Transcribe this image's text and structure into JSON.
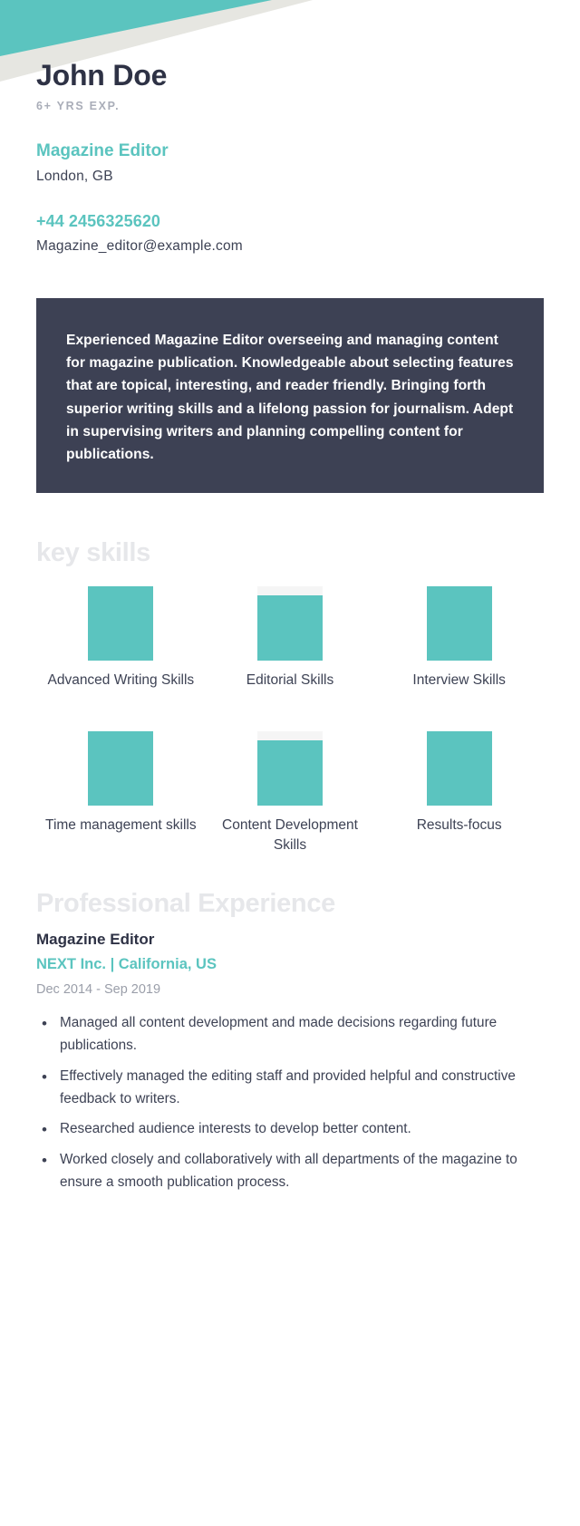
{
  "theme": {
    "accent": "#5bc4bf",
    "dark_panel": "#3d4154",
    "heading_ghost": "#e6e7ea",
    "body_text": "#3d4254",
    "muted_text": "#9a9ea9",
    "banner_gray": "#e6e6e1"
  },
  "header": {
    "full_name": "John Doe",
    "years_experience": "6+ YRS EXP."
  },
  "role": {
    "title": "Magazine Editor",
    "location": "London, GB"
  },
  "contact": {
    "phone": "+44 2456325620",
    "email": "Magazine_editor@example.com"
  },
  "summary": {
    "text": "Experienced Magazine Editor overseeing and managing content for magazine publication. Knowledgeable about selecting features that are topical, interesting, and reader friendly. Bringing forth superior writing skills and a lifelong passion for journalism. Adept in supervising writers and planning compelling content for publications."
  },
  "key_skills": {
    "heading": "key skills",
    "items": [
      {
        "label": "Advanced Writing Skills",
        "level_pct": 100
      },
      {
        "label": "Editorial Skills",
        "level_pct": 88
      },
      {
        "label": "Interview Skills",
        "level_pct": 100
      },
      {
        "label": "Time management skills",
        "level_pct": 100
      },
      {
        "label": "Content Development Skills",
        "level_pct": 88
      },
      {
        "label": "Results-focus",
        "level_pct": 100
      }
    ]
  },
  "experience": {
    "heading": "Professional Experience",
    "jobs": [
      {
        "title": "Magazine Editor",
        "company": "NEXT Inc. | California, US",
        "dates": "Dec 2014 - Sep 2019",
        "bullets": [
          "Managed all content development and made decisions regarding future publications.",
          "Effectively managed the editing staff and provided helpful and constructive feedback to writers.",
          "Researched audience interests to develop better content.",
          "Worked closely and collaboratively with all departments of the magazine to ensure a smooth publication process."
        ]
      }
    ]
  }
}
